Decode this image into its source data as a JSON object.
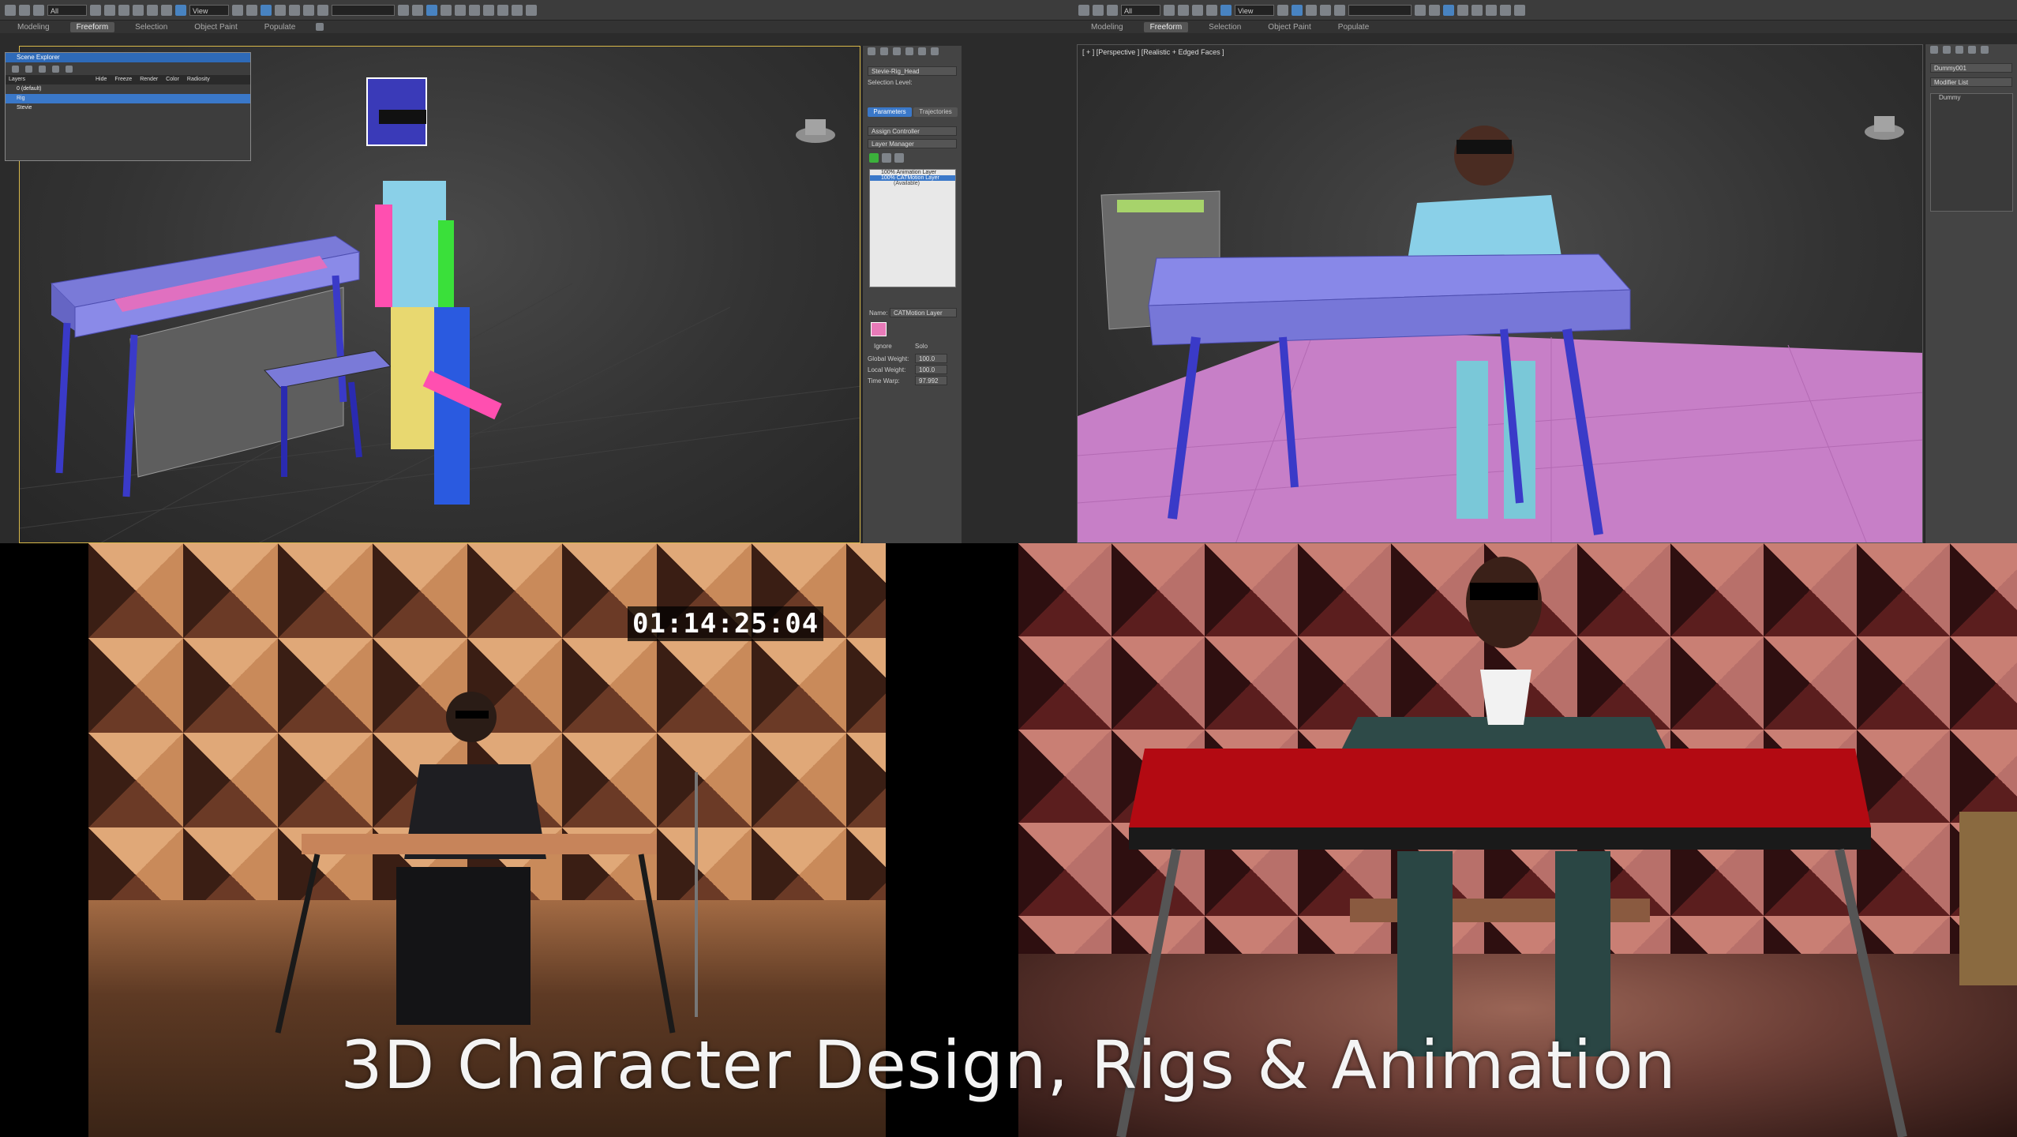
{
  "left_app": {
    "ribbon_tabs": [
      "Modeling",
      "Freeform",
      "Selection",
      "Object Paint",
      "Populate"
    ],
    "active_tab": "Freeform",
    "toolbar_dropdowns": [
      "All",
      "View"
    ],
    "command_panel": {
      "object_name": "Stevie-Rig_Head",
      "selection_level_label": "Selection Level:",
      "tab_parameters": "Parameters",
      "tab_trajectories": "Trajectories",
      "assign_controller": "Assign Controller",
      "layer_manager": "Layer Manager",
      "layers": [
        "100% Animation Layer",
        "100% CATMotion Layer",
        "(Available)"
      ],
      "name_label": "Name:",
      "name_value": "CATMotion Layer",
      "ignore_label": "Ignore",
      "solo_label": "Solo",
      "global_weight_label": "Global Weight:",
      "global_weight_value": "100.0",
      "local_weight_label": "Local Weight:",
      "local_weight_value": "100.0",
      "time_warp_label": "Time Warp:",
      "time_warp_value": "97.992"
    },
    "layer_explorer": {
      "title": "Scene Explorer",
      "columns": [
        "Layers",
        "Hide",
        "Freeze",
        "Render",
        "Color",
        "Radiosity"
      ],
      "rows": [
        "0 (default)",
        "Rig",
        "Stevie"
      ]
    }
  },
  "right_app": {
    "ribbon_tabs": [
      "Modeling",
      "Freeform",
      "Selection",
      "Object Paint",
      "Populate"
    ],
    "active_tab": "Freeform",
    "viewport_label": "[ + ] [Perspective ] [Realistic + Edged Faces ]",
    "object_name": "Dummy001",
    "modifier_list": "Modifier List",
    "stack_item": "Dummy"
  },
  "video_left": {
    "timecode": "01:14:25:04"
  },
  "caption": "3D Character Design, Rigs & Animation",
  "colors": {
    "ui_dark": "#2b2b2b",
    "selection_blue": "#3a78c9",
    "floor_pink": "#c77fc7",
    "piano_red": "#b30a12",
    "piano_purple": "#7b7de0"
  }
}
